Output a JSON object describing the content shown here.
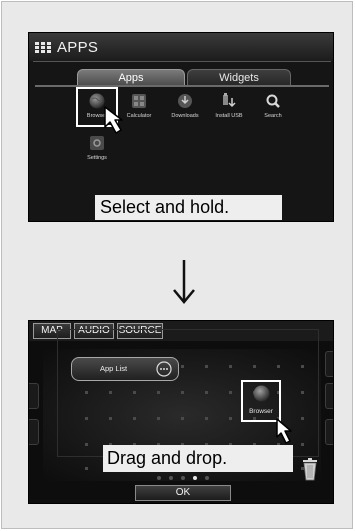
{
  "step1": {
    "title": "APPS",
    "tabs": [
      {
        "label": "Apps",
        "active": true
      },
      {
        "label": "Widgets",
        "active": false
      }
    ],
    "apps": [
      {
        "label": "Browser",
        "icon": "globe-icon"
      },
      {
        "label": "Calculator",
        "icon": "calculator-icon"
      },
      {
        "label": "Downloads",
        "icon": "download-icon"
      },
      {
        "label": "Install USB",
        "icon": "usb-install-icon"
      },
      {
        "label": "Search",
        "icon": "magnifier-icon"
      },
      {
        "label": "Settings",
        "icon": "settings-icon"
      }
    ],
    "caption": "Select and hold."
  },
  "step2": {
    "source_buttons": [
      "MAP",
      "AUDIO",
      "SOURCE"
    ],
    "app_list_label": "App List",
    "dragged_app_label": "Browser",
    "caption": "Drag and drop.",
    "ok_label": "OK",
    "page_count": 5,
    "current_page": 4
  },
  "colors": {
    "screen_bg": "#151515",
    "highlight": "#ffffff",
    "caption_bg": "#eeeeee",
    "panel_bg": "#e9e9e9"
  }
}
